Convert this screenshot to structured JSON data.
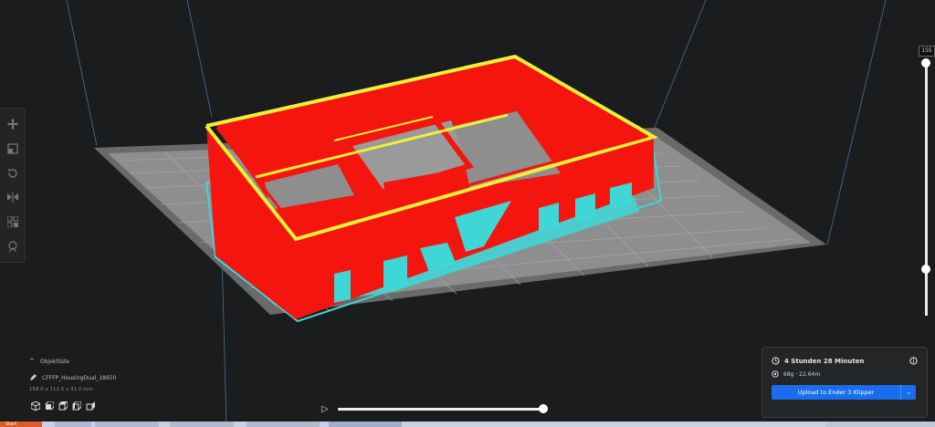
{
  "viewport": {
    "colors": {
      "background": "#1b1c1e",
      "build_plate": "#8e8e8e",
      "plate_grid": "#a9a9a9",
      "model_wall": "#f5150f",
      "model_top": "#f0f03a",
      "support": "#3fd6d6"
    }
  },
  "toolbar": {
    "tools": [
      {
        "icon": "move-icon"
      },
      {
        "icon": "scale-icon"
      },
      {
        "icon": "rotate-icon"
      },
      {
        "icon": "mirror-icon"
      },
      {
        "icon": "per-model-settings-icon"
      },
      {
        "icon": "support-blocker-icon"
      }
    ]
  },
  "layer_slider": {
    "value": "155"
  },
  "object_list": {
    "title": "Objektliste",
    "object_name": "CFFFP_HousingDual_18650",
    "dimensions": "158.0 x 112.5 x 31.0 mm"
  },
  "simulation": {
    "progress": 1.0
  },
  "print_info": {
    "time": "4 Stunden 28 Minuten",
    "material": "68g · 22.64m",
    "upload_label": "Upload to Ender 3 Klipper",
    "accent": "#196ef0"
  },
  "taskbar": {
    "start_label": "Start"
  }
}
